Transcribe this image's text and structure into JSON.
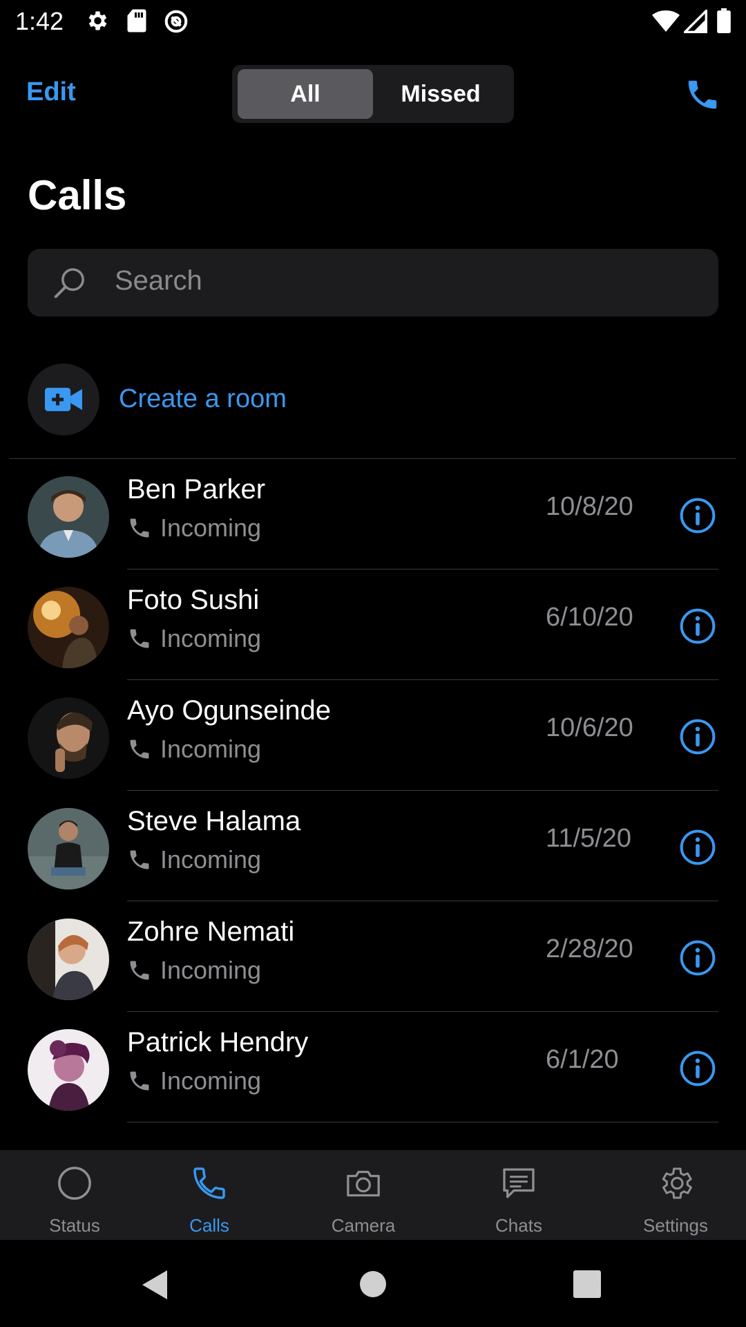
{
  "status_bar": {
    "time": "1:42"
  },
  "header": {
    "edit_label": "Edit",
    "segments": [
      "All",
      "Missed"
    ],
    "selected_segment": "All"
  },
  "page_title": "Calls",
  "search": {
    "placeholder": "Search"
  },
  "create_room": {
    "label": "Create a room"
  },
  "calls": [
    {
      "name": "Ben Parker",
      "type": "Incoming",
      "date": "10/8/20"
    },
    {
      "name": "Foto Sushi",
      "type": "Incoming",
      "date": "6/10/20"
    },
    {
      "name": "Ayo Ogunseinde",
      "type": "Incoming",
      "date": "10/6/20"
    },
    {
      "name": "Steve Halama",
      "type": "Incoming",
      "date": "11/5/20"
    },
    {
      "name": "Zohre Nemati",
      "type": "Incoming",
      "date": "2/28/20"
    },
    {
      "name": "Patrick Hendry",
      "type": "Incoming",
      "date": "6/1/20"
    }
  ],
  "tab_bar": {
    "tabs": [
      {
        "label": "Status",
        "icon": "circle-icon"
      },
      {
        "label": "Calls",
        "icon": "phone-icon"
      },
      {
        "label": "Camera",
        "icon": "camera-icon"
      },
      {
        "label": "Chats",
        "icon": "chat-icon"
      },
      {
        "label": "Settings",
        "icon": "gear-icon"
      }
    ],
    "active": "Calls"
  },
  "colors": {
    "accent": "#3a98f0",
    "background": "#000000",
    "surface": "#1c1c1e",
    "secondary_text": "#8e8e93"
  }
}
